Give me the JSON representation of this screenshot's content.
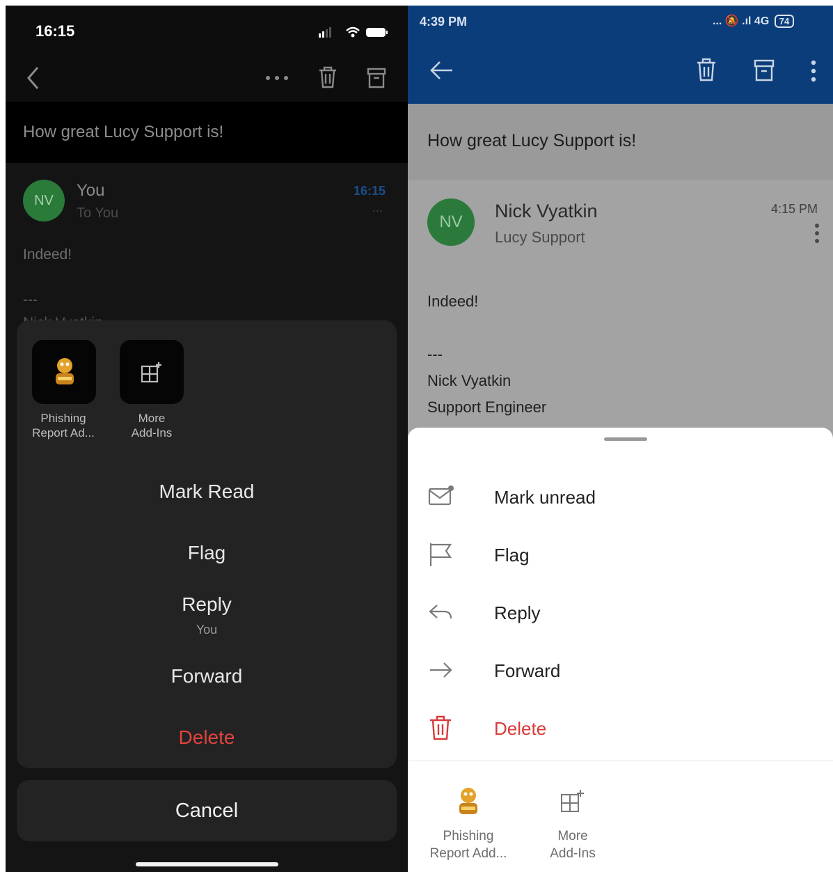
{
  "ios": {
    "status_time": "16:15",
    "subject": "How great Lucy Support is!",
    "message": {
      "avatar_initials": "NV",
      "sender": "You",
      "recipient": "To You",
      "time": "16:15",
      "more": "...",
      "body": [
        "Indeed!",
        "---",
        "Nick Vyatkin"
      ]
    },
    "addins": [
      {
        "label_line1": "Phishing",
        "label_line2": "Report Ad...",
        "icon": "lucy-logo-icon"
      },
      {
        "label_line1": "More",
        "label_line2": "Add-Ins",
        "icon": "add-ins-icon"
      }
    ],
    "actions": {
      "mark_read": "Mark Read",
      "flag": "Flag",
      "reply": "Reply",
      "reply_sub": "You",
      "forward": "Forward",
      "delete": "Delete"
    },
    "cancel": "Cancel",
    "colors": {
      "delete": "#e0443e",
      "time": "#1c4d8a"
    }
  },
  "android": {
    "status_time": "4:39 PM",
    "status_icons": "... 🔕 .ıl 4G",
    "battery": "74",
    "subject": "How great Lucy Support is!",
    "message": {
      "avatar_initials": "NV",
      "sender": "Nick Vyatkin",
      "org": "Lucy Support",
      "time": "4:15 PM",
      "body": [
        "Indeed!",
        "---",
        "Nick Vyatkin",
        "Support Engineer"
      ]
    },
    "actions": [
      {
        "label": "Mark unread",
        "icon": "mail-unread-icon"
      },
      {
        "label": "Flag",
        "icon": "flag-icon"
      },
      {
        "label": "Reply",
        "icon": "reply-icon"
      },
      {
        "label": "Forward",
        "icon": "forward-icon"
      },
      {
        "label": "Delete",
        "icon": "trash-icon"
      }
    ],
    "addins": [
      {
        "label_line1": "Phishing",
        "label_line2": "Report Add...",
        "icon": "lucy-logo-icon"
      },
      {
        "label_line1": "More",
        "label_line2": "Add-Ins",
        "icon": "add-ins-icon"
      }
    ],
    "colors": {
      "appbar": "#0b3d7a",
      "delete": "#d83a3a"
    }
  }
}
